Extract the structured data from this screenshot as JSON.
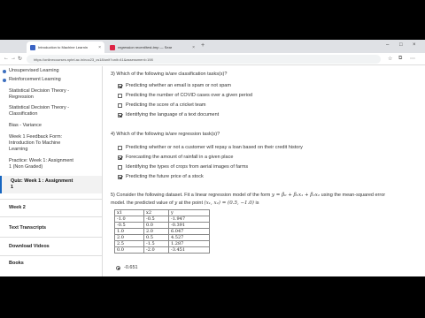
{
  "tabs": [
    {
      "title": "Introduction to Machine Learnin",
      "favicon": "#3b64c4",
      "active": true
    },
    {
      "title": "regression recent/test-tmp — Sear",
      "favicon": "#d24",
      "active": false
    }
  ],
  "address": {
    "url": "https://onlinecourses.nptel.ac.in/noc23_cs18/unit?unit=41&assessment=198"
  },
  "sidebar": {
    "items": [
      {
        "label": "Unsupervised Learning",
        "kind": "top"
      },
      {
        "label": "Reinforcement Learning",
        "kind": "top"
      },
      {
        "label": "Statistical Decision Theory -",
        "kind": "sub"
      },
      {
        "label": "Regression",
        "kind": "sub"
      },
      {
        "label": "Statistical Decision Theory -",
        "kind": "sub"
      },
      {
        "label": "Classification",
        "kind": "sub"
      },
      {
        "label": "Bias - Variance",
        "kind": "sub"
      },
      {
        "label": "Week 1 Feedback Form:",
        "kind": "sub"
      },
      {
        "label": "Introduction To Machine",
        "kind": "sub"
      },
      {
        "label": "Learning",
        "kind": "sub"
      },
      {
        "label": "Practice: Week 1: Assignment",
        "kind": "sub"
      },
      {
        "label": "1 (Non Graded)",
        "kind": "sub"
      },
      {
        "label": "Quiz: Week 1 : Assignment",
        "kind": "active"
      },
      {
        "label": "1",
        "kind": "active"
      }
    ],
    "sections": [
      "Week 2",
      "Text Transcripts",
      "Download Videos",
      "Books"
    ]
  },
  "questions": {
    "q3": {
      "text": "3)    Which of the following is/are classification tasks(s)?",
      "options": [
        {
          "label": "Predicting whether an email is spam or not spam",
          "checked": true
        },
        {
          "label": "Predicting the number of COVID cases over a given period",
          "checked": false
        },
        {
          "label": "Predicting the score of a cricket team",
          "checked": false
        },
        {
          "label": "Identifying the language of a text document",
          "checked": true
        }
      ]
    },
    "q4": {
      "text": "4)    Which of the following is/are regression task(s)?",
      "options": [
        {
          "label": "Predicting whether or not a customer will repay a loan based on their credit history",
          "checked": false
        },
        {
          "label": "Forecasting the amount of rainfall in a given place",
          "checked": true
        },
        {
          "label": "Identifying the types of crops from aerial images of farms",
          "checked": false
        },
        {
          "label": "Predicting the future price of a stock",
          "checked": true
        }
      ]
    },
    "q5": {
      "line1_pre": "5)    Consider the following dataset. Fit a linear regression model of the form ",
      "line1_math": "y = β₀ + β₁x₁ + β₂x₂",
      "line1_post": " using the mean-squared error",
      "line2_pre": "model. the predicted value of ",
      "line2_math1": "y",
      "line2_mid": " at the point ",
      "line2_math2": "(x₁, x₂) = (0.5, −1.0)",
      "line2_post": " is",
      "table": {
        "headers": [
          "x1",
          "x2",
          "y"
        ],
        "rows": [
          [
            "-1.0",
            "-0.5",
            "-1.947"
          ],
          [
            "-0.5",
            "0.0",
            "-0.391"
          ],
          [
            "1.0",
            "2.0",
            "6.047"
          ],
          [
            "2.0",
            "0.5",
            "4.527"
          ],
          [
            "2.5",
            "-1.5",
            "1.287"
          ],
          [
            "0.0",
            "-2.0",
            "-3.451"
          ]
        ]
      },
      "answer": "-0.651"
    }
  }
}
